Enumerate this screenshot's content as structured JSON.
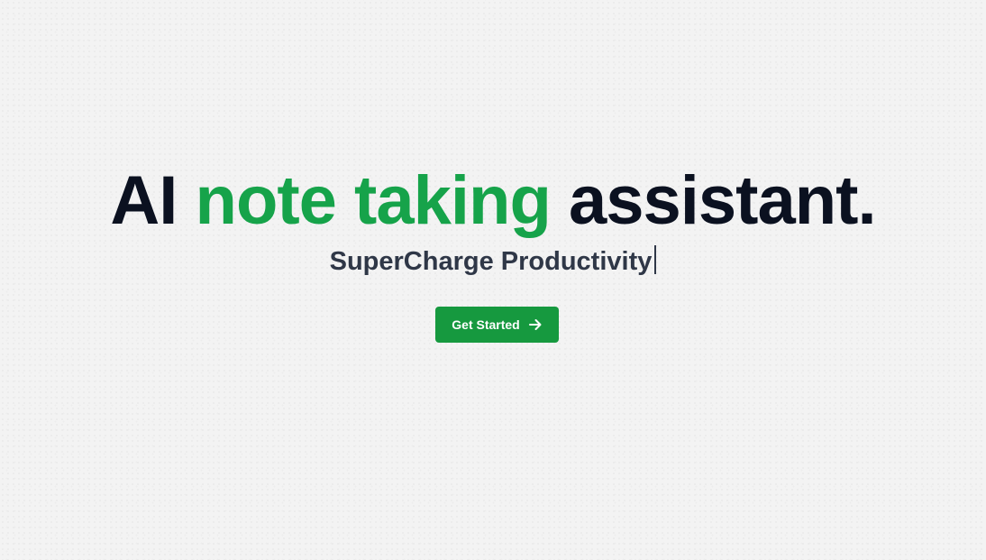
{
  "hero": {
    "headline": {
      "prefix": "AI",
      "accent": "note taking",
      "suffix": "assistant."
    },
    "subline": "SuperCharge Productivity",
    "cta_label": "Get Started",
    "cta_icon": "arrow-right-icon"
  },
  "colors": {
    "background": "#f3f3f3",
    "headline_text": "#0b1120",
    "accent": "#16a34a",
    "subline_text": "#2f3747",
    "button_bg": "#16993f",
    "button_text": "#ffffff"
  }
}
